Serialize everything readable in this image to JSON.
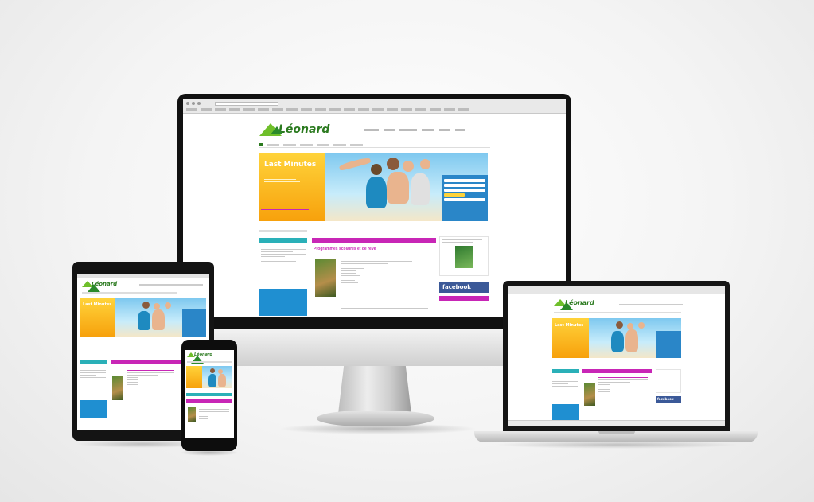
{
  "brand": {
    "logo_text": "Léonard"
  },
  "hero": {
    "promo_title": "Last Minutes"
  },
  "sidebar_ad": {
    "facebook_label": "facebook"
  },
  "main": {
    "section_title": "Programmes scolaires et de rêve"
  },
  "colors": {
    "brand_green": "#2b7a1f",
    "promo_orange": "#f7a10c",
    "accent_magenta": "#c826b6",
    "accent_teal": "#2ab0b8",
    "booking_blue": "#2a86c8",
    "facebook_blue": "#3b5998"
  }
}
